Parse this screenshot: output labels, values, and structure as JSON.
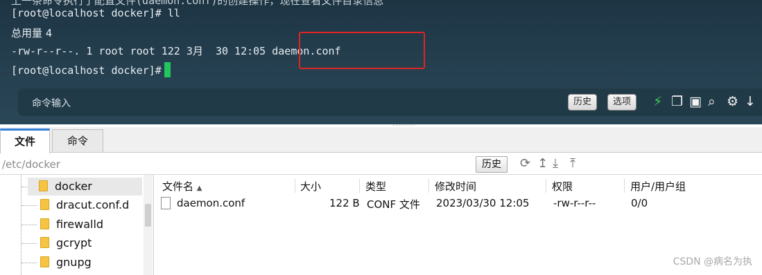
{
  "terminal": {
    "cut_line": "上一条命令执行了配置文件(daemon.conf)的创建操作，现在查看文件目录信息",
    "lines": [
      "[root@localhost docker]# ll",
      "总用量 4",
      "-rw-r--r--. 1 root root 122 3月  30 12:05 daemon.conf"
    ],
    "prompt": "[root@localhost docker]#",
    "cursor_color": "#22c55e",
    "highlight_color": "#e02424"
  },
  "command_bar": {
    "label": "命令输入",
    "history_button": "历史",
    "options_button": "选项",
    "icons": [
      "lightning-icon",
      "copy-icon",
      "paste-icon",
      "search-icon",
      "gear-icon",
      "arrow-down-icon"
    ]
  },
  "tabs": [
    {
      "label": "文件",
      "active": true
    },
    {
      "label": "命令",
      "active": false
    }
  ],
  "pathbar": {
    "path": "/etc/docker",
    "history_button": "历史",
    "icons": [
      "refresh-icon",
      "up-icon",
      "download-icon",
      "upload-icon"
    ]
  },
  "tree": {
    "items": [
      {
        "label": "docker",
        "selected": true
      },
      {
        "label": "dracut.conf.d",
        "selected": false
      },
      {
        "label": "firewalld",
        "selected": false
      },
      {
        "label": "gcrypt",
        "selected": false
      },
      {
        "label": "gnupg",
        "selected": false
      }
    ]
  },
  "files": {
    "columns": [
      "文件名",
      "大小",
      "类型",
      "修改时间",
      "权限",
      "用户/用户组"
    ],
    "sort_indicator": "▲",
    "rows": [
      {
        "name": "daemon.conf",
        "size": "122 B",
        "type": "CONF 文件",
        "modified": "2023/03/30 12:05",
        "permissions": "-rw-r--r--",
        "owner": "0/0"
      }
    ]
  },
  "watermark": "CSDN @病名为执"
}
